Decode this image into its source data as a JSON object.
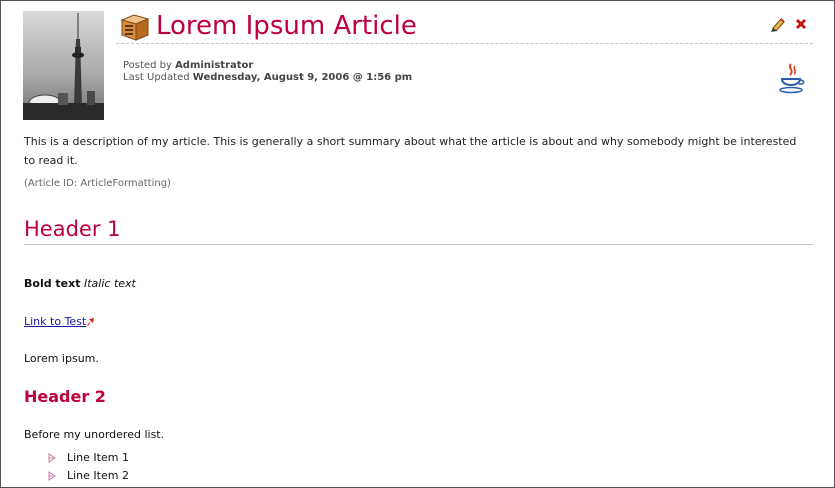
{
  "article": {
    "title": "Lorem Ipsum Article",
    "posted_by_label": "Posted by",
    "author": "Administrator",
    "last_updated_label": "Last Updated",
    "last_updated": "Wednesday, August 9, 2006 @ 1:56 pm",
    "description": "This is a description of my article. This is generally a short summary about what the article is about and why somebody might be interested to read it.",
    "article_id": "(Article ID: ArticleFormatting)"
  },
  "icons": {
    "title": "article-box-icon",
    "edit": "pencil-edit-icon",
    "delete": "red-x-delete-icon",
    "language": "java-cup-icon",
    "thumbnail": "cn-tower-photo",
    "external_link": "external-link-arrow-icon",
    "bullet": "arrow-bullet-icon"
  },
  "content": {
    "header1": "Header 1",
    "bold_text": "Bold text",
    "italic_text": "Italic text",
    "link_text": "Link to Test",
    "lorem": "Lorem ipsum.",
    "header2": "Header 2",
    "before_list": "Before my unordered list.",
    "list_items": [
      "Line Item 1",
      "Line Item 2"
    ]
  },
  "colors": {
    "accent": "#c0003c",
    "link": "#1a1aa6",
    "rule": "#c8c8c8"
  }
}
